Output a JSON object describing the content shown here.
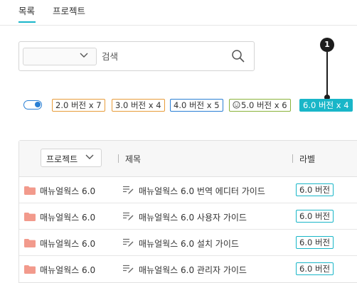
{
  "tabs": [
    {
      "label": "목록",
      "active": true
    },
    {
      "label": "프로젝트",
      "active": false
    }
  ],
  "search": {
    "select_value": "",
    "placeholder": "검색"
  },
  "callout": {
    "number": "1"
  },
  "filters": [
    {
      "label": "2.0 버전 x 7",
      "color": "#e89c3a"
    },
    {
      "label": "3.0 버전 x 4",
      "color": "#e89c3a"
    },
    {
      "label": "4.0 버전 x 5",
      "color": "#2a7fd4"
    },
    {
      "label": "5.0 버전 x 6",
      "color": "#8ab23a",
      "icon": "smile-icon"
    },
    {
      "label": "6.0 버전 x 4",
      "color": "#19b6c8",
      "active": true
    }
  ],
  "table": {
    "project_select": "프로젝트",
    "headers": {
      "title": "제목",
      "label": "라벨"
    },
    "rows": [
      {
        "project": "매뉴얼웍스 6.0",
        "title": "매뉴얼웍스 6.0 번역 에디터 가이드",
        "badge": "6.0 버전"
      },
      {
        "project": "매뉴얼웍스 6.0",
        "title": "매뉴얼웍스 6.0 사용자 가이드",
        "badge": "6.0 버전"
      },
      {
        "project": "매뉴얼웍스 6.0",
        "title": "매뉴얼웍스 6.0 설치 가이드",
        "badge": "6.0 버전"
      },
      {
        "project": "매뉴얼웍스 6.0",
        "title": "매뉴얼웍스 6.0 관리자 가이드",
        "badge": "6.0 버전"
      }
    ]
  },
  "colors": {
    "accent": "#19b6c8",
    "folder": "#f29a8c",
    "toggle": "#2a7fd4"
  }
}
